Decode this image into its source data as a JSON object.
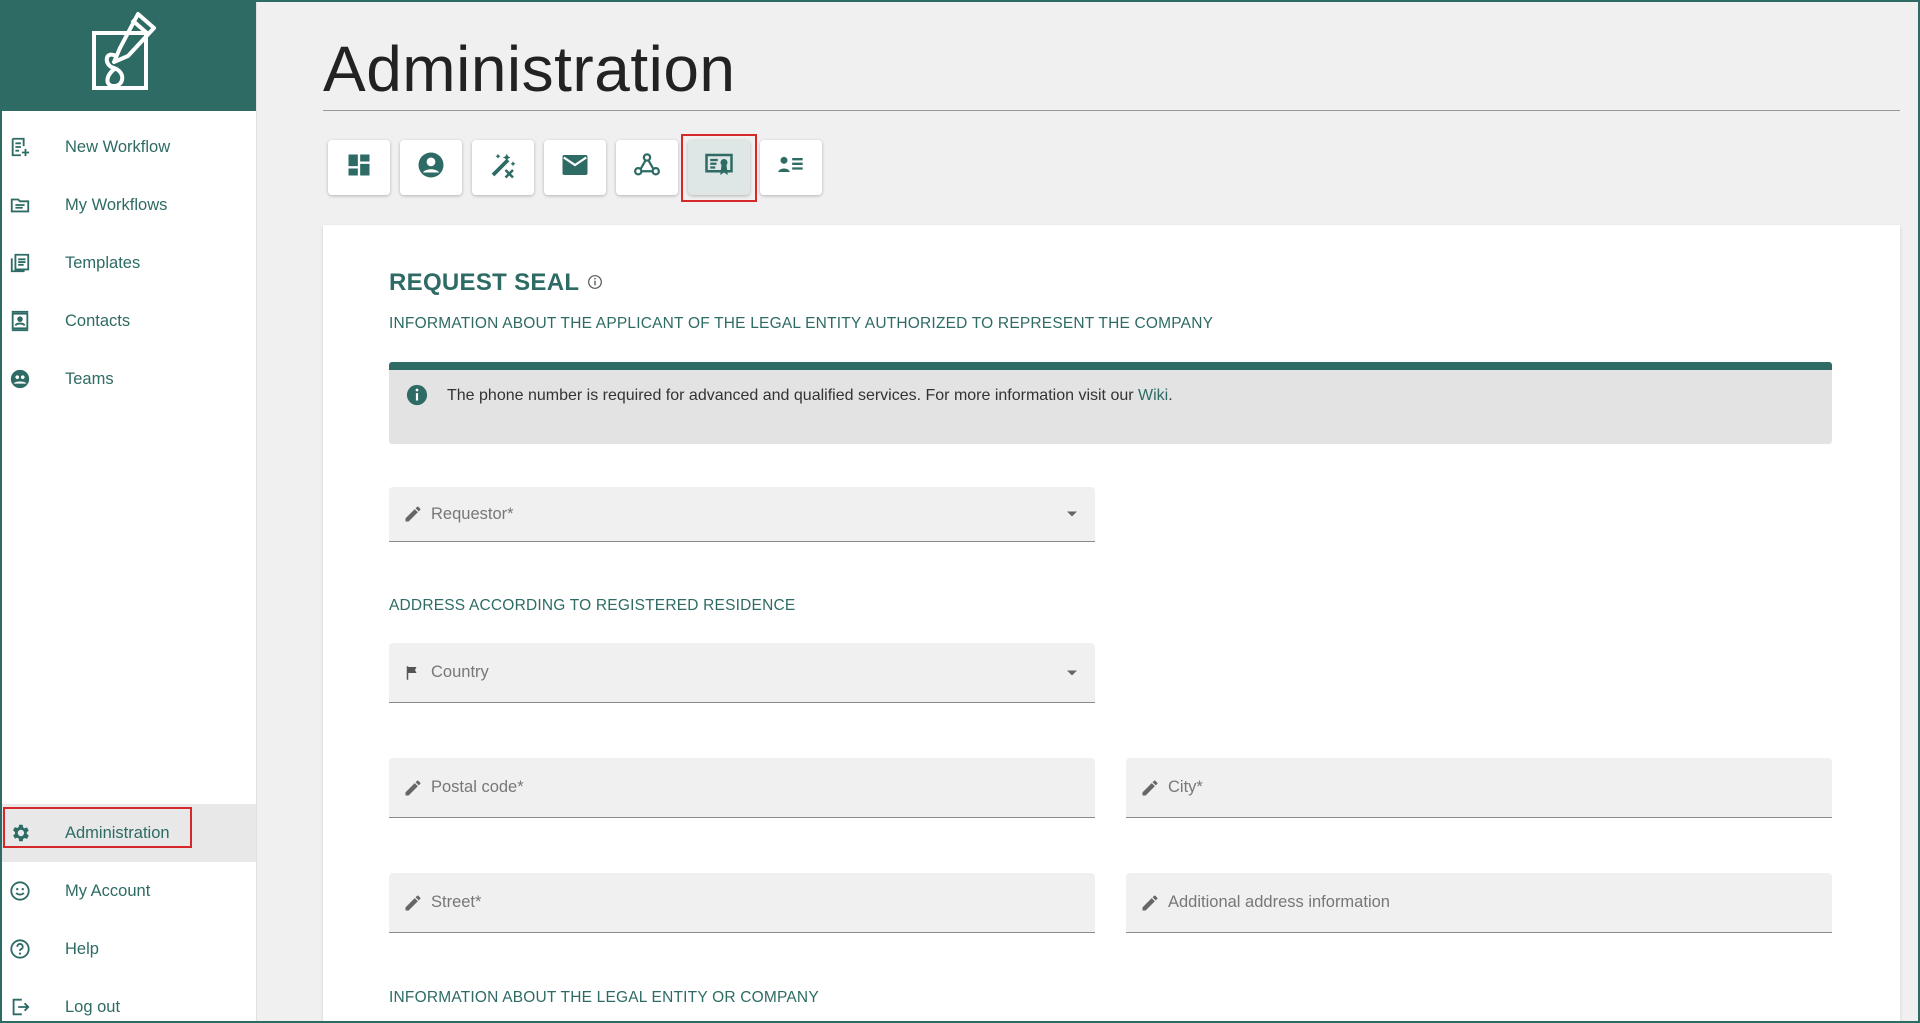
{
  "sidebar": {
    "top_items": [
      {
        "label": "New Workflow",
        "icon": "new-workflow-icon"
      },
      {
        "label": "My Workflows",
        "icon": "my-workflows-icon"
      },
      {
        "label": "Templates",
        "icon": "templates-icon"
      },
      {
        "label": "Contacts",
        "icon": "contacts-icon"
      },
      {
        "label": "Teams",
        "icon": "teams-icon"
      }
    ],
    "bottom_items": [
      {
        "label": "Administration",
        "icon": "gear-icon",
        "active": true
      },
      {
        "label": "My Account",
        "icon": "smiley-icon"
      },
      {
        "label": "Help",
        "icon": "help-icon"
      },
      {
        "label": "Log out",
        "icon": "logout-icon"
      }
    ]
  },
  "main": {
    "title": "Administration",
    "toolbar": [
      {
        "icon": "dashboard-icon"
      },
      {
        "icon": "account-circle-icon"
      },
      {
        "icon": "magic-wand-icon"
      },
      {
        "icon": "mail-icon"
      },
      {
        "icon": "webhook-icon"
      },
      {
        "icon": "seal-certificate-icon",
        "active": true
      },
      {
        "icon": "contact-list-icon"
      }
    ],
    "section_title": "REQUEST SEAL",
    "applicant_heading": "INFORMATION ABOUT THE APPLICANT OF THE LEGAL ENTITY AUTHORIZED TO REPRESENT THE COMPANY",
    "info": {
      "text": "The phone number is required for advanced and qualified services. For more information visit our ",
      "link": "Wiki",
      "suffix": "."
    },
    "requestor_placeholder": "Requestor*",
    "address_heading": "ADDRESS ACCORDING TO REGISTERED RESIDENCE",
    "country_placeholder": "Country",
    "postal_placeholder": "Postal code*",
    "city_placeholder": "City*",
    "street_placeholder": "Street*",
    "additional_placeholder": "Additional address information",
    "entity_heading": "INFORMATION ABOUT THE LEGAL ENTITY OR COMPANY"
  },
  "colors": {
    "accent": "#2d6b64",
    "highlight": "#d62828"
  }
}
